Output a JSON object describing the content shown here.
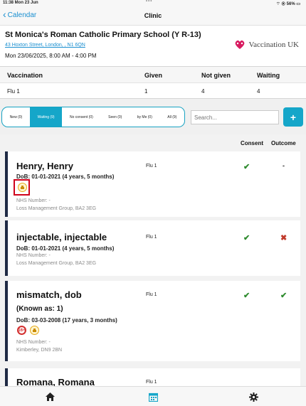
{
  "status_bar": {
    "time_date": "11:38  Mon 23 Jun",
    "dots": "•••",
    "battery": "⌔ ◉ 56% ▭"
  },
  "nav": {
    "back_label": "Calendar",
    "title": "Clinic"
  },
  "school": {
    "name": "St Monica's Roman Catholic Primary School (Y R-13)",
    "address": "43 Hoxton Street, London, , N1 6QN",
    "datetime": "Mon 23/06/2025, 8:00 AM - 4:00 PM",
    "logo_text": "Vaccination UK"
  },
  "summary": {
    "headers": [
      "Vaccination",
      "Given",
      "Not given",
      "Waiting"
    ],
    "row": [
      "Flu 1",
      "1",
      "4",
      "4"
    ]
  },
  "filters": [
    {
      "label": "New (0)",
      "active": false
    },
    {
      "label": "Waiting (9)",
      "active": true
    },
    {
      "label": "No consent (0)",
      "active": false
    },
    {
      "label": "Seen (0)",
      "active": false
    },
    {
      "label": "by Me (0)",
      "active": false
    },
    {
      "label": "All (9)",
      "active": false
    }
  ],
  "search": {
    "placeholder": "Search..."
  },
  "add_button": "+",
  "columns": {
    "consent": "Consent",
    "outcome": "Outcome"
  },
  "patients": [
    {
      "name": "Henry, Henry",
      "dob": "DoB: 01-01-2021 (4 years, 5 months)",
      "nhs": "NHS Number: -",
      "address": "Loss Management Group, BA2 3EG",
      "vaccination": "Flu 1",
      "consent": "✔",
      "outcome": "-"
    },
    {
      "name": "injectable, injectable",
      "dob": "DoB: 01-01-2021 (4 years, 5 months)",
      "nhs": "NHS Number: -",
      "address": "Loss Management Group, BA2 3EG",
      "vaccination": "Flu 1",
      "consent": "✔",
      "outcome": "✖"
    },
    {
      "name": "mismatch, dob",
      "known_as": "(Known as: 1)",
      "dob": "DoB: 03-03-2008 (17 years, 3 months)",
      "age_badge": "16+",
      "nhs": "NHS Number: -",
      "address": "Kimberley, DN9 2BN",
      "vaccination": "Flu 1",
      "consent": "✔",
      "outcome": "✔"
    },
    {
      "name": "Romana, Romana",
      "vaccination": "Flu 1"
    }
  ],
  "colors": {
    "accent": "#15a6c9",
    "link": "#1a8fd0",
    "card_border": "#1f2a44",
    "tick": "#2e8b2e",
    "cross": "#c0392b",
    "highlight": "#d0021b"
  },
  "tabs": [
    {
      "icon": "home-icon"
    },
    {
      "icon": "calendar-icon",
      "active": true
    },
    {
      "icon": "gear-icon"
    }
  ]
}
